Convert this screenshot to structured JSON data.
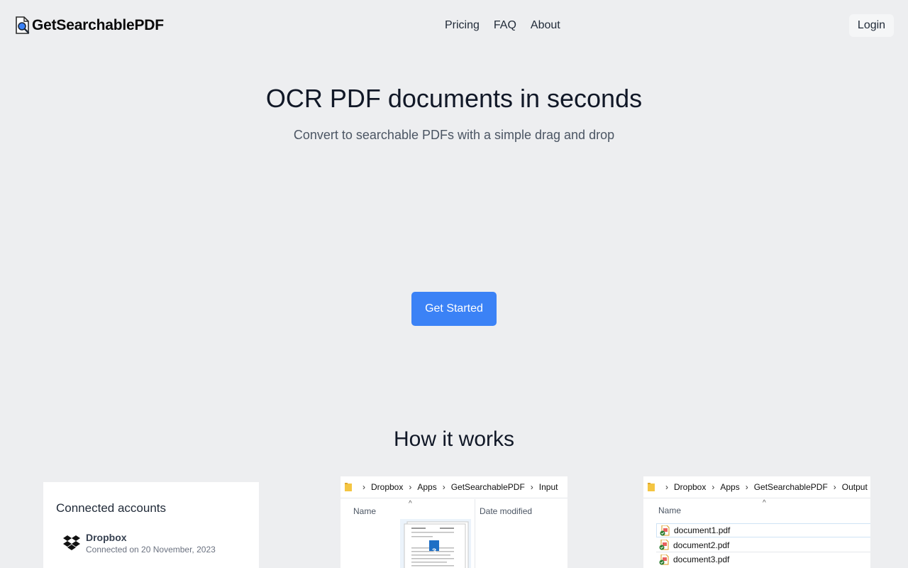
{
  "brand": {
    "name": "GetSearchablePDF"
  },
  "nav": {
    "items": [
      "Pricing",
      "FAQ",
      "About"
    ],
    "login_label": "Login"
  },
  "hero": {
    "title": "OCR PDF documents in seconds",
    "subtitle": "Convert to searchable PDFs with a simple drag and drop",
    "cta_label": "Get Started"
  },
  "how": {
    "title": "How it works"
  },
  "accounts_card": {
    "title": "Connected accounts",
    "account_name": "Dropbox",
    "account_status": "Connected on 20 November, 2023"
  },
  "input_explorer": {
    "breadcrumb": [
      "Dropbox",
      "Apps",
      "GetSearchablePDF",
      "Input"
    ],
    "col_name": "Name",
    "col_date": "Date modified",
    "drag_count": "3"
  },
  "output_explorer": {
    "breadcrumb": [
      "Dropbox",
      "Apps",
      "GetSearchablePDF",
      "Output"
    ],
    "col_name": "Name",
    "files": [
      "document1.pdf",
      "document2.pdf",
      "document3.pdf"
    ]
  },
  "colors": {
    "accent": "#3b82f6",
    "background": "#edeef0"
  },
  "icons": {
    "logo": "pdf-search-icon",
    "account": "dropbox-icon",
    "folder": "folder-icon",
    "file": "pdf-file-icon"
  }
}
